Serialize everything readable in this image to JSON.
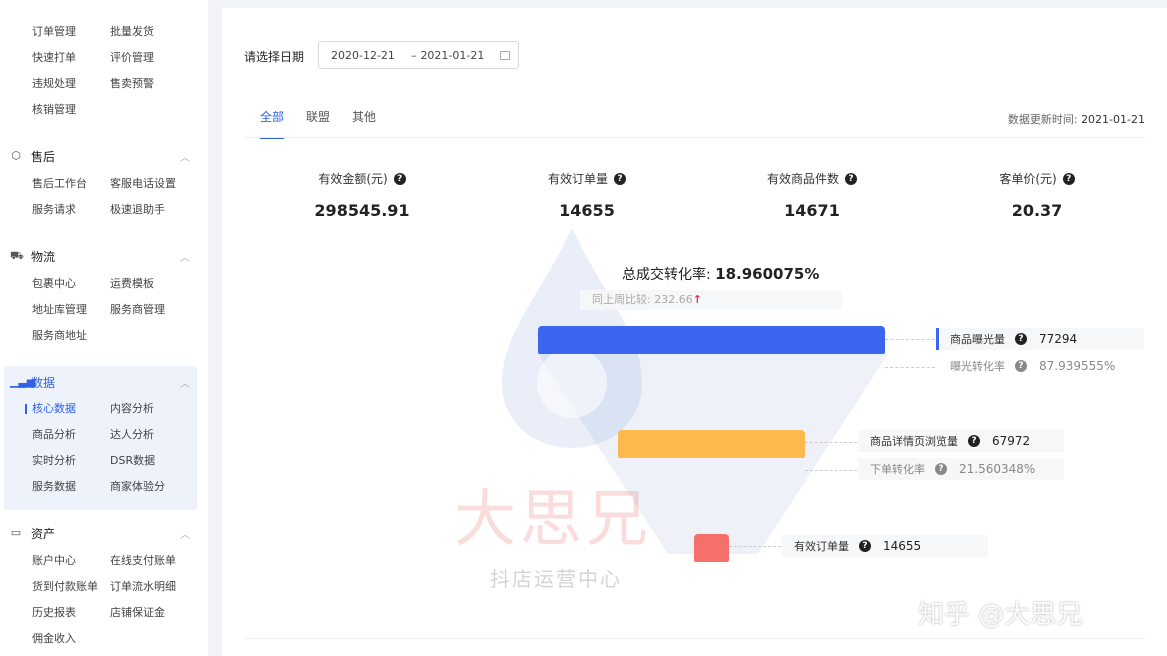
{
  "sidebar": {
    "top_items": [
      "订单管理",
      "批量发货",
      "快速打单",
      "评价管理",
      "违规处理",
      "售卖预警",
      "核销管理"
    ],
    "sections": [
      {
        "title": "售后",
        "items": [
          "售后工作台",
          "客服电话设置",
          "服务请求",
          "极速退助手"
        ]
      },
      {
        "title": "物流",
        "items": [
          "包裹中心",
          "运费模板",
          "地址库管理",
          "服务商管理",
          "服务商地址"
        ]
      },
      {
        "title": "数据",
        "items": [
          "核心数据",
          "内容分析",
          "商品分析",
          "达人分析",
          "实时分析",
          "DSR数据",
          "服务数据",
          "商家体验分"
        ]
      },
      {
        "title": "资产",
        "items": [
          "账户中心",
          "在线支付账单",
          "货到付款账单",
          "订单流水明细",
          "历史报表",
          "店铺保证金",
          "佣金收入"
        ]
      }
    ]
  },
  "filter": {
    "label": "请选择日期",
    "start": "2020-12-21",
    "sep": "–",
    "end": "2021-01-21"
  },
  "tabs": [
    "全部",
    "联盟",
    "其他"
  ],
  "update": {
    "label": "数据更新时间:",
    "value": "2021-01-21"
  },
  "metrics": [
    {
      "label": "有效金额(元)",
      "value": "298545.91"
    },
    {
      "label": "有效订单量",
      "value": "14655"
    },
    {
      "label": "有效商品件数",
      "value": "14671"
    },
    {
      "label": "客单价(元)",
      "value": "20.37"
    }
  ],
  "conversion": {
    "label": "总成交转化率:",
    "value": "18.960075%",
    "compare_label": "同上周比较:",
    "compare_value": "232.66",
    "compare_arrow": "↑"
  },
  "funnel": [
    {
      "label": "商品曝光量",
      "value": "77294",
      "sub_label": "曝光转化率",
      "sub_value": "87.939555%",
      "color": "#3c66f0"
    },
    {
      "label": "商品详情页浏览量",
      "value": "67972",
      "sub_label": "下单转化率",
      "sub_value": "21.560348%",
      "color": "#fdb94e"
    },
    {
      "label": "有效订单量",
      "value": "14655",
      "color": "#f5706a"
    }
  ],
  "watermarks": {
    "brand": "大思兄",
    "sub": "抖店运营中心",
    "zhihu": "知乎 @大思兄"
  }
}
